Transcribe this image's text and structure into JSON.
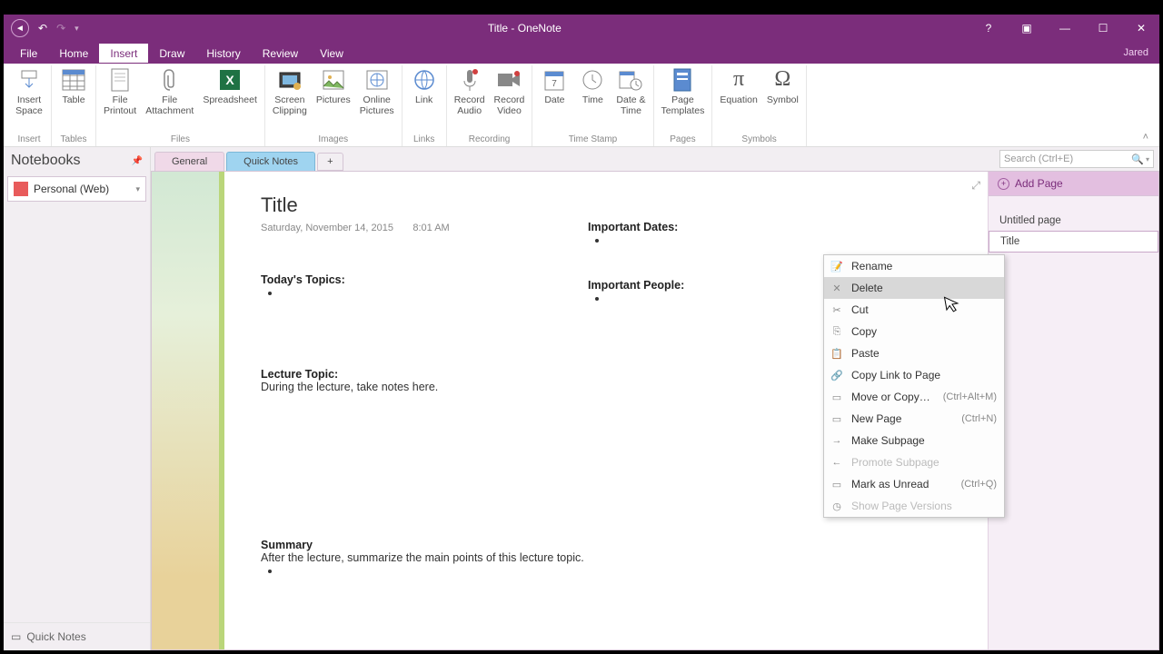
{
  "titlebar": {
    "title": "Title - OneNote",
    "user": "Jared"
  },
  "menu": {
    "tabs": [
      "File",
      "Home",
      "Insert",
      "Draw",
      "History",
      "Review",
      "View"
    ],
    "active": "Insert"
  },
  "ribbon": {
    "groups": [
      {
        "label": "Insert",
        "items": [
          {
            "label": "Insert\nSpace"
          }
        ]
      },
      {
        "label": "Tables",
        "items": [
          {
            "label": "Table"
          }
        ]
      },
      {
        "label": "Files",
        "items": [
          {
            "label": "File\nPrintout"
          },
          {
            "label": "File\nAttachment"
          },
          {
            "label": "Spreadsheet"
          }
        ]
      },
      {
        "label": "Images",
        "items": [
          {
            "label": "Screen\nClipping"
          },
          {
            "label": "Pictures"
          },
          {
            "label": "Online\nPictures"
          }
        ]
      },
      {
        "label": "Links",
        "items": [
          {
            "label": "Link"
          }
        ]
      },
      {
        "label": "Recording",
        "items": [
          {
            "label": "Record\nAudio"
          },
          {
            "label": "Record\nVideo"
          }
        ]
      },
      {
        "label": "Time Stamp",
        "items": [
          {
            "label": "Date"
          },
          {
            "label": "Time"
          },
          {
            "label": "Date &\nTime"
          }
        ]
      },
      {
        "label": "Pages",
        "items": [
          {
            "label": "Page\nTemplates"
          }
        ]
      },
      {
        "label": "Symbols",
        "items": [
          {
            "label": "Equation"
          },
          {
            "label": "Symbol"
          }
        ]
      }
    ]
  },
  "sidebar": {
    "header": "Notebooks",
    "notebook": "Personal (Web)",
    "quicknotes": "Quick Notes"
  },
  "sectionTabs": {
    "general": "General",
    "quick": "Quick Notes"
  },
  "search": {
    "placeholder": "Search (Ctrl+E)"
  },
  "page": {
    "title": "Title",
    "date": "Saturday, November 14, 2015",
    "time": "8:01 AM",
    "todays_topics": "Today's Topics:",
    "important_dates": "Important Dates:",
    "important_people": "Important People:",
    "lecture_topic": "Lecture Topic:",
    "lecture_body": "During the lecture, take notes here.",
    "summary": "Summary",
    "summary_body": "After the lecture, summarize the main points of this lecture topic."
  },
  "pagesPane": {
    "addPage": "Add Page",
    "items": [
      "Untitled page",
      "Title"
    ]
  },
  "context": {
    "items": [
      {
        "label": "Rename",
        "icon": "✎"
      },
      {
        "label": "Delete",
        "icon": "✕",
        "hl": true
      },
      {
        "label": "Cut",
        "icon": "✂"
      },
      {
        "label": "Copy",
        "icon": "⎘"
      },
      {
        "label": "Paste",
        "icon": "📋"
      },
      {
        "label": "Copy Link to Page",
        "icon": "🔗"
      },
      {
        "label": "Move or Copy…",
        "kbd": "(Ctrl+Alt+M)",
        "icon": "▭"
      },
      {
        "label": "New Page",
        "kbd": "(Ctrl+N)",
        "icon": "▭"
      },
      {
        "label": "Make Subpage",
        "icon": "→"
      },
      {
        "label": "Promote Subpage",
        "icon": "←",
        "disabled": true
      },
      {
        "label": "Mark as Unread",
        "kbd": "(Ctrl+Q)",
        "icon": "▭"
      },
      {
        "label": "Show Page Versions",
        "icon": "◷",
        "disabled": true
      }
    ]
  }
}
